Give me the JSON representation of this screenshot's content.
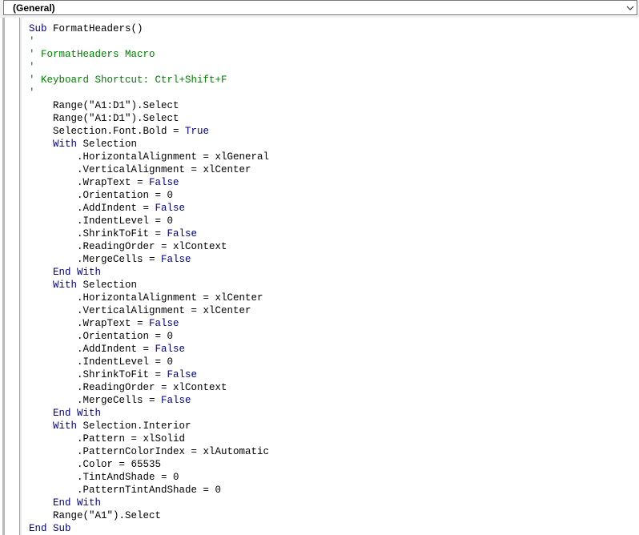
{
  "procedure_combo": {
    "selected": "(General)"
  },
  "code_lines": [
    [
      {
        "t": "Sub",
        "k": "kw"
      },
      {
        "t": " FormatHeaders()"
      }
    ],
    [
      {
        "t": "'",
        "k": "cm"
      }
    ],
    [
      {
        "t": "' FormatHeaders Macro",
        "k": "cm"
      }
    ],
    [
      {
        "t": "'",
        "k": "cm"
      }
    ],
    [
      {
        "t": "' Keyboard Shortcut: Ctrl+Shift+F",
        "k": "cm"
      }
    ],
    [
      {
        "t": "'",
        "k": "cm"
      }
    ],
    [
      {
        "t": "    Range(\"A1:D1\").Select"
      }
    ],
    [
      {
        "t": "    Range(\"A1:D1\").Select"
      }
    ],
    [
      {
        "t": "    Selection.Font.Bold = "
      },
      {
        "t": "True",
        "k": "kw"
      }
    ],
    [
      {
        "t": "    "
      },
      {
        "t": "With",
        "k": "kw"
      },
      {
        "t": " Selection"
      }
    ],
    [
      {
        "t": "        .HorizontalAlignment = xlGeneral"
      }
    ],
    [
      {
        "t": "        .VerticalAlignment = xlCenter"
      }
    ],
    [
      {
        "t": "        .WrapText = "
      },
      {
        "t": "False",
        "k": "kw"
      }
    ],
    [
      {
        "t": "        .Orientation = 0"
      }
    ],
    [
      {
        "t": "        .AddIndent = "
      },
      {
        "t": "False",
        "k": "kw"
      }
    ],
    [
      {
        "t": "        .IndentLevel = 0"
      }
    ],
    [
      {
        "t": "        .ShrinkToFit = "
      },
      {
        "t": "False",
        "k": "kw"
      }
    ],
    [
      {
        "t": "        .ReadingOrder = xlContext"
      }
    ],
    [
      {
        "t": "        .MergeCells = "
      },
      {
        "t": "False",
        "k": "kw"
      }
    ],
    [
      {
        "t": "    "
      },
      {
        "t": "End With",
        "k": "kw"
      }
    ],
    [
      {
        "t": "    "
      },
      {
        "t": "With",
        "k": "kw"
      },
      {
        "t": " Selection"
      }
    ],
    [
      {
        "t": "        .HorizontalAlignment = xlCenter"
      }
    ],
    [
      {
        "t": "        .VerticalAlignment = xlCenter"
      }
    ],
    [
      {
        "t": "        .WrapText = "
      },
      {
        "t": "False",
        "k": "kw"
      }
    ],
    [
      {
        "t": "        .Orientation = 0"
      }
    ],
    [
      {
        "t": "        .AddIndent = "
      },
      {
        "t": "False",
        "k": "kw"
      }
    ],
    [
      {
        "t": "        .IndentLevel = 0"
      }
    ],
    [
      {
        "t": "        .ShrinkToFit = "
      },
      {
        "t": "False",
        "k": "kw"
      }
    ],
    [
      {
        "t": "        .ReadingOrder = xlContext"
      }
    ],
    [
      {
        "t": "        .MergeCells = "
      },
      {
        "t": "False",
        "k": "kw"
      }
    ],
    [
      {
        "t": "    "
      },
      {
        "t": "End With",
        "k": "kw"
      }
    ],
    [
      {
        "t": "    "
      },
      {
        "t": "With",
        "k": "kw"
      },
      {
        "t": " Selection.Interior"
      }
    ],
    [
      {
        "t": "        .Pattern = xlSolid"
      }
    ],
    [
      {
        "t": "        .PatternColorIndex = xlAutomatic"
      }
    ],
    [
      {
        "t": "        .Color = 65535"
      }
    ],
    [
      {
        "t": "        .TintAndShade = 0"
      }
    ],
    [
      {
        "t": "        .PatternTintAndShade = 0"
      }
    ],
    [
      {
        "t": "    "
      },
      {
        "t": "End With",
        "k": "kw"
      }
    ],
    [
      {
        "t": "    Range(\"A1\").Select"
      }
    ],
    [
      {
        "t": "End Sub",
        "k": "kw"
      }
    ]
  ],
  "colors": {
    "keyword": "#00008b",
    "comment": "#008000",
    "text": "#000000"
  },
  "icons": {
    "combo_arrow": "chevron-down-icon"
  }
}
